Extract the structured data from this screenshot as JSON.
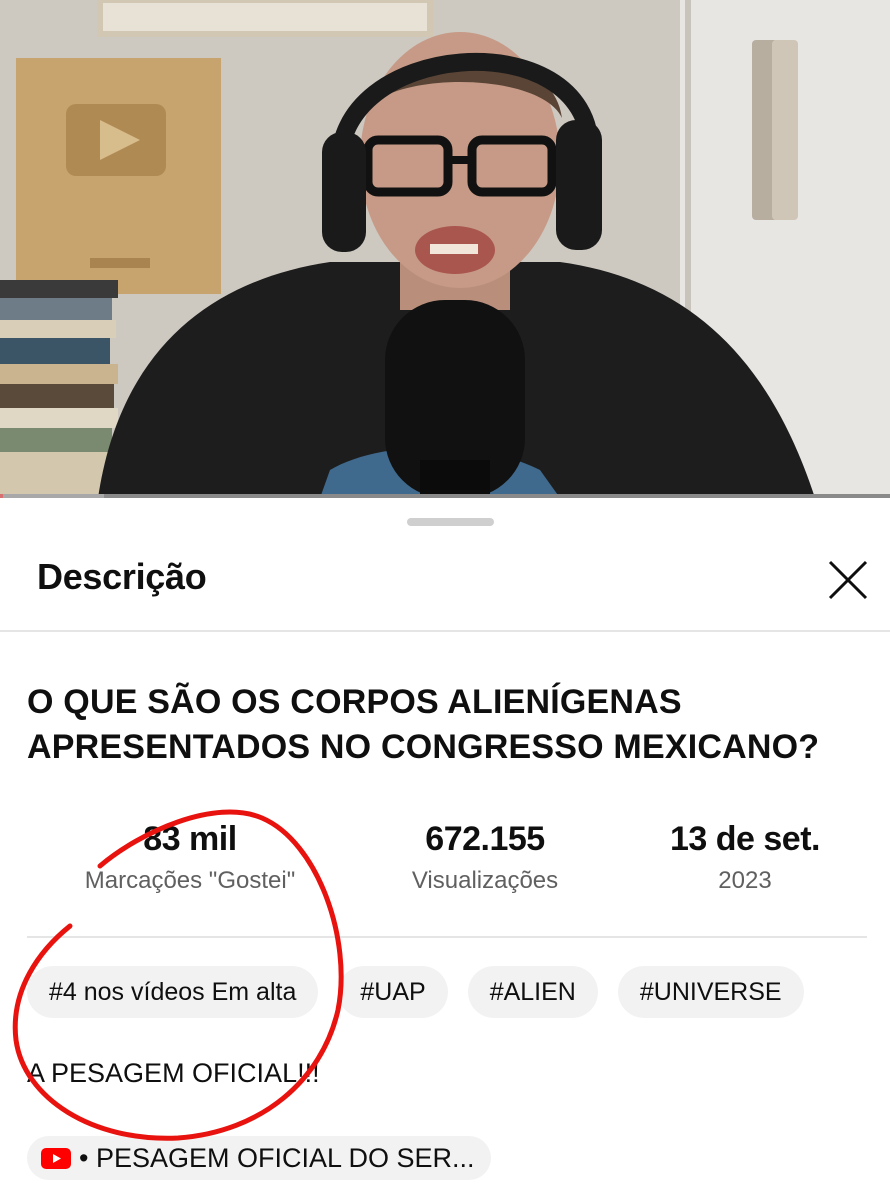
{
  "video": {
    "progress_fraction": 0.003
  },
  "sheet": {
    "title": "Descrição"
  },
  "video_title": "O QUE SÃO OS CORPOS ALIENÍGENAS APRESENTADOS NO CONGRESSO MEXICANO?",
  "stats": [
    {
      "value": "83 mil",
      "label": "Marcações \"Gostei\""
    },
    {
      "value": "672.155",
      "label": "Visualizações"
    },
    {
      "value": "13 de set.",
      "label": "2023"
    }
  ],
  "chips": [
    "#4 nos vídeos Em alta",
    "#UAP",
    "#ALIEN",
    "#UNIVERSE"
  ],
  "description_text": "A PESAGEM OFICIAL!!!",
  "linked_video": {
    "icon": "youtube-icon",
    "text": "• PESAGEM OFICIAL DO SER..."
  },
  "colors": {
    "accent": "#ff0000",
    "annotation": "#e8130f",
    "chip_bg": "#f2f2f2",
    "secondary_text": "#606060"
  }
}
